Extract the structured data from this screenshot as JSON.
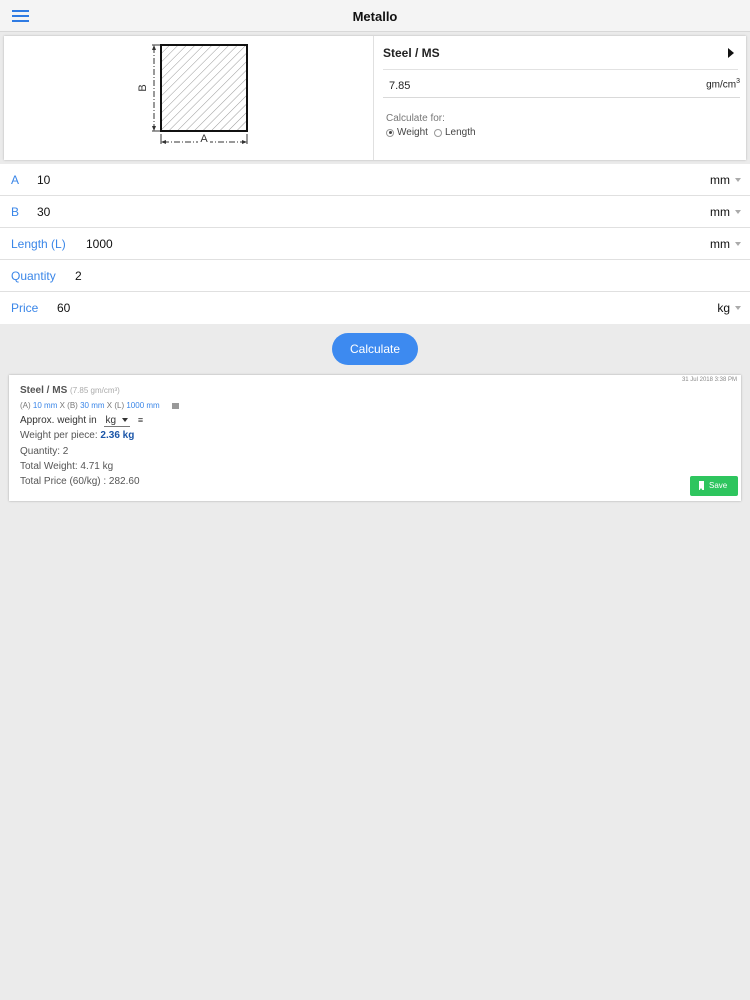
{
  "app": {
    "title": "Metallo"
  },
  "diagram": {
    "label_a": "A",
    "label_b": "B"
  },
  "material": {
    "name": "Steel / MS",
    "density": "7.85",
    "density_unit": "gm/cm",
    "density_unit_sup": "3",
    "calculate_for_label": "Calculate for:",
    "options": [
      {
        "label": "Weight",
        "selected": true
      },
      {
        "label": "Length",
        "selected": false
      }
    ]
  },
  "inputs": {
    "a": {
      "label": "A",
      "value": "10",
      "unit": "mm"
    },
    "b": {
      "label": "B",
      "value": "30",
      "unit": "mm"
    },
    "length": {
      "label": "Length (L)",
      "value": "1000",
      "unit": "mm"
    },
    "quantity": {
      "label": "Quantity",
      "value": "2"
    },
    "price": {
      "label": "Price",
      "value": "60",
      "unit": "kg"
    }
  },
  "calculate_label": "Calculate",
  "result": {
    "timestamp": "31 Jul 2018 3:38 PM",
    "title": "Steel / MS",
    "subtitle": "(7.85 gm/cm³)",
    "dims": {
      "a_label": "(A)",
      "a_value": "10 mm",
      "x1": "X",
      "b_label": "(B)",
      "b_value": "30 mm",
      "x2": "X",
      "l_label": "(L)",
      "l_value": "1000 mm"
    },
    "approx_label": "Approx. weight in",
    "approx_unit": "kg",
    "menu_glyph": "≡",
    "weight_per_piece_label": "Weight per piece:",
    "weight_per_piece_value": "2.36 kg",
    "quantity_line": "Quantity: 2",
    "total_weight_line": "Total Weight: 4.71 kg",
    "total_price_line": "Total Price (60/kg) : 282.60",
    "save_label": "Save"
  },
  "colors": {
    "accent": "#3a86e8",
    "button": "#3d8af0",
    "save": "#2ec55e",
    "background": "#ebebeb"
  }
}
